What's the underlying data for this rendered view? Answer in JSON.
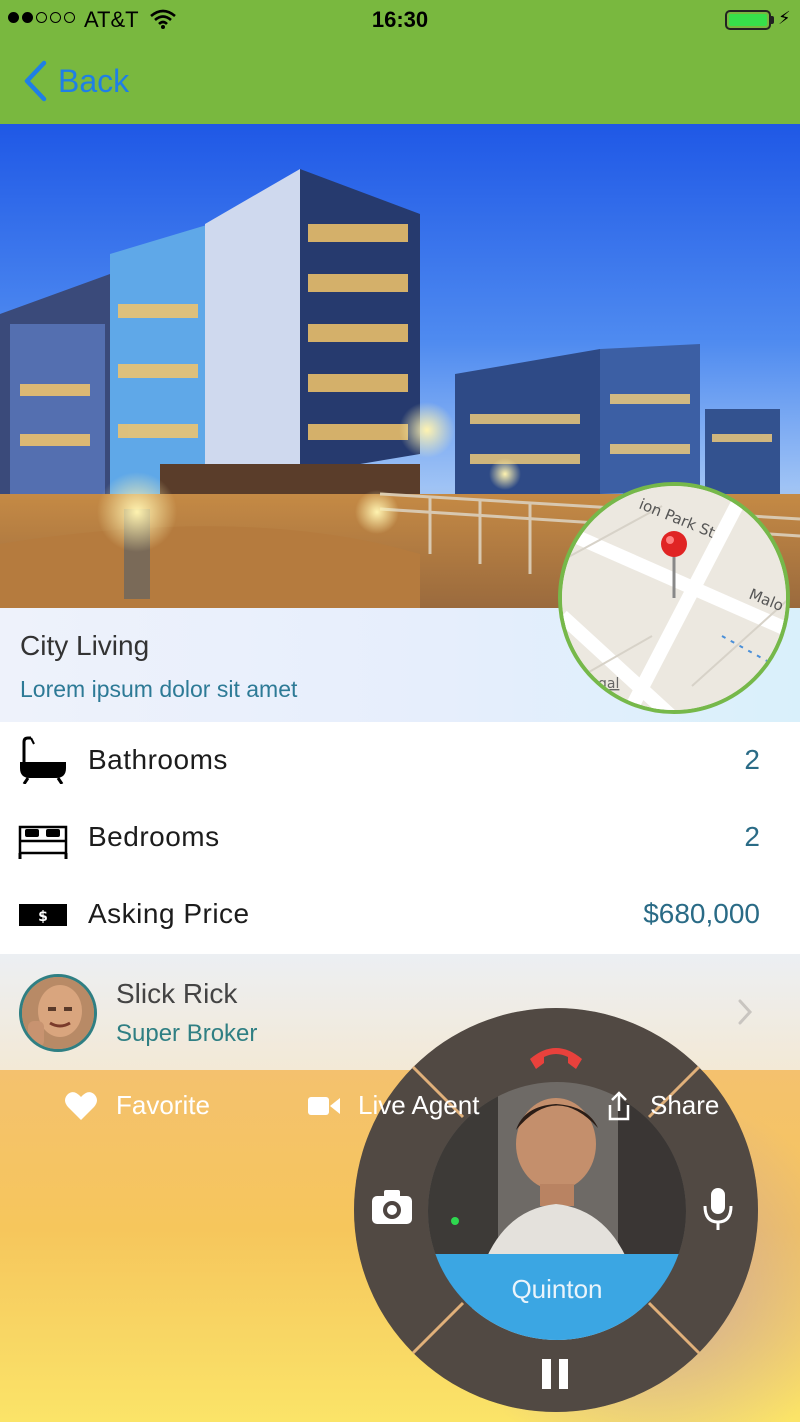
{
  "status_bar": {
    "carrier": "AT&T",
    "time": "16:30",
    "signal_bars": 2,
    "signal_max": 5,
    "battery_level": 1.0,
    "charging": true,
    "bolt_glyph": "⚡"
  },
  "nav": {
    "back_label": "Back",
    "back_icon": "chevron-left-icon"
  },
  "listing": {
    "title": "City Living",
    "subtitle": "Lorem ipsum dolor sit amet",
    "map": {
      "street_1": "ion Park St",
      "street_2": "Malo",
      "corner_label": "gal"
    }
  },
  "details": [
    {
      "icon": "bathtub-icon",
      "label": "Bathrooms",
      "value": "2"
    },
    {
      "icon": "bed-icon",
      "label": "Bedrooms",
      "value": "2"
    },
    {
      "icon": "money-icon",
      "label": "Asking Price",
      "value": "$680,000"
    }
  ],
  "agent": {
    "name": "Slick Rick",
    "role": "Super Broker"
  },
  "actions": [
    {
      "icon": "heart-icon",
      "label": "Favorite"
    },
    {
      "icon": "video-camera-icon",
      "label": "Live Agent"
    },
    {
      "icon": "share-icon",
      "label": "Share"
    }
  ],
  "call": {
    "caller_name": "Quinton"
  },
  "colors": {
    "nav_green": "#79b83f",
    "link_blue": "#1f7fe6",
    "teal": "#2a6b86",
    "hangup_red": "#e8413c",
    "caller_blue": "#3ba6e3",
    "live_green": "#2ed84f"
  }
}
